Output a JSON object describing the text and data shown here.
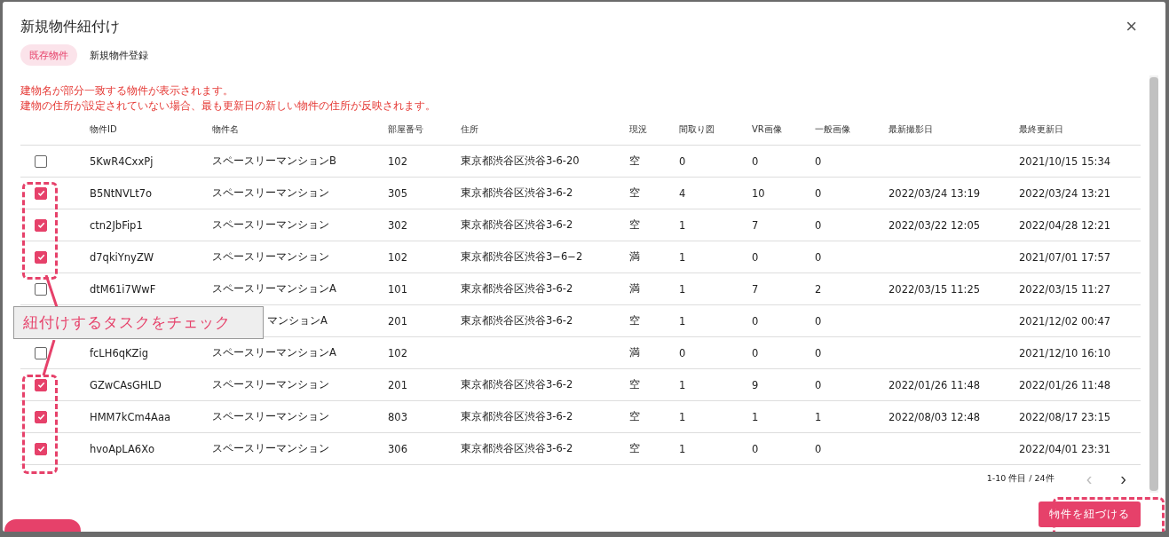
{
  "dialog": {
    "title": "新規物件紐付け",
    "close": "×"
  },
  "tabs": [
    {
      "label": "既存物件",
      "selected": true
    },
    {
      "label": "新規物件登録",
      "selected": false
    }
  ],
  "notes": [
    "建物名が部分一致する物件が表示されます。",
    "建物の住所が設定されていない場合、最も更新日の新しい物件の住所が反映されます。"
  ],
  "table": {
    "columns": [
      "物件ID",
      "物件名",
      "部屋番号",
      "住所",
      "現況",
      "間取り図",
      "VR画像",
      "一般画像",
      "最新撮影日",
      "最終更新日"
    ],
    "rows": [
      {
        "checked": false,
        "cells": [
          "5KwR4CxxPj",
          "スペースリーマンションB",
          "102",
          "東京都渋谷区渋谷3-6-20",
          "空",
          "0",
          "0",
          "0",
          null,
          "2021/10/15 15:34"
        ]
      },
      {
        "checked": true,
        "cells": [
          "B5NtNVLt7o",
          "スペースリーマンション",
          "305",
          "東京都渋谷区渋谷3-6-2",
          "空",
          "4",
          "10",
          "0",
          "2022/03/24 13:19",
          "2022/03/24 13:21"
        ]
      },
      {
        "checked": true,
        "cells": [
          "ctn2JbFip1",
          "スペースリーマンション",
          "302",
          "東京都渋谷区渋谷3-6-2",
          "空",
          "1",
          "7",
          "0",
          "2022/03/22 12:05",
          "2022/04/28 12:21"
        ]
      },
      {
        "checked": true,
        "cells": [
          "d7qkiYnyZW",
          "スペースリーマンション",
          "102",
          "東京都渋谷区渋谷3−6−2",
          "満",
          "1",
          "0",
          "0",
          null,
          "2021/07/01 17:57"
        ]
      },
      {
        "checked": false,
        "cells": [
          "dtM61i7WwF",
          "スペースリーマンションA",
          "101",
          "東京都渋谷区渋谷3-6-2",
          "満",
          "1",
          "7",
          "2",
          "2022/03/15 11:25",
          "2022/03/15 11:27"
        ]
      },
      {
        "cells": [
          null,
          "マンションA",
          "201",
          "東京都渋谷区渋谷3-6-2",
          "空",
          "1",
          "0",
          "0",
          null,
          "2021/12/02 00:47"
        ]
      },
      {
        "checked": false,
        "cells": [
          "fcLH6qKZig",
          "スペースリーマンションA",
          "102",
          null,
          "満",
          "0",
          "0",
          "0",
          null,
          "2021/12/10 16:10"
        ]
      },
      {
        "checked": true,
        "cells": [
          "GZwCAsGHLD",
          "スペースリーマンション",
          "201",
          "東京都渋谷区渋谷3-6-2",
          "空",
          "1",
          "9",
          "0",
          "2022/01/26 11:48",
          "2022/01/26 11:48"
        ]
      },
      {
        "checked": true,
        "cells": [
          "HMM7kCm4Aaa",
          "スペースリーマンション",
          "803",
          "東京都渋谷区渋谷3-6-2",
          "空",
          "1",
          "1",
          "1",
          "2022/08/03 12:48",
          "2022/08/17 23:15"
        ]
      },
      {
        "checked": true,
        "cells": [
          "hvoApLA6Xo",
          "スペースリーマンション",
          "306",
          "東京都渋谷区渋谷3-6-2",
          "空",
          "1",
          "0",
          "0",
          null,
          "2022/04/01 23:31"
        ]
      }
    ]
  },
  "pagination": {
    "range": "1-10 件目 / 24件",
    "prev": "‹",
    "next": "›",
    "prev_disabled": true
  },
  "submit_button": "物件を紐づける",
  "annotation": {
    "callout": "紐付けするタスクをチェック"
  }
}
